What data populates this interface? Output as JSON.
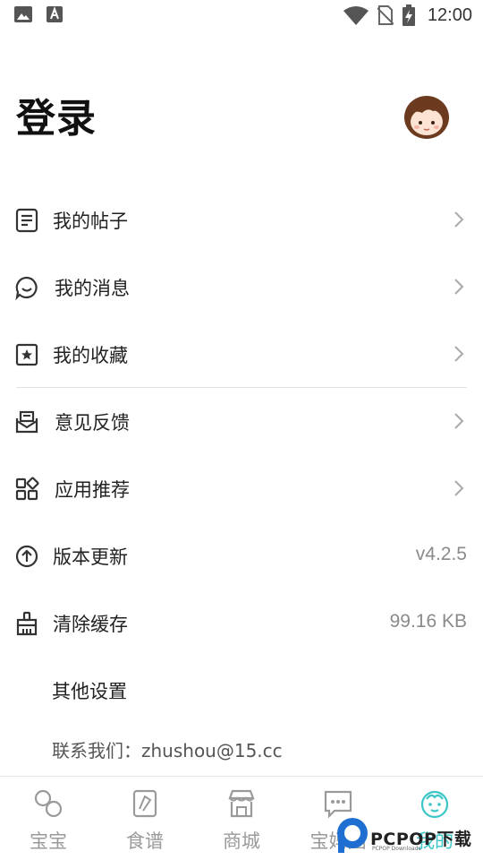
{
  "status_bar": {
    "time": "12:00",
    "left_icons": [
      "image-icon",
      "font-icon"
    ],
    "right_icons": [
      "wifi-icon",
      "no-sim-icon",
      "battery-charging-icon"
    ]
  },
  "header": {
    "title": "登录",
    "avatar_icon": "girl-avatar-icon"
  },
  "menu": {
    "items": [
      {
        "label": "我的帖子",
        "icon": "document-icon",
        "has_chevron": true
      },
      {
        "label": "我的消息",
        "icon": "chat-smile-icon",
        "has_chevron": true
      },
      {
        "label": "我的收藏",
        "icon": "star-box-icon",
        "has_chevron": true
      },
      {
        "label": "意见反馈",
        "icon": "mail-icon",
        "has_chevron": true
      },
      {
        "label": "应用推荐",
        "icon": "apps-grid-icon",
        "has_chevron": true
      },
      {
        "label": "版本更新",
        "icon": "arrow-up-circle-icon",
        "value": "v4.2.5"
      },
      {
        "label": "清除缓存",
        "icon": "broom-icon",
        "value": "99.16 KB"
      },
      {
        "label": "其他设置"
      }
    ],
    "contact": "联系我们：zhushou@15.cc"
  },
  "tabs": [
    {
      "label": "宝宝",
      "icon": "baby-rattle-icon",
      "active": false
    },
    {
      "label": "食谱",
      "icon": "recipe-icon",
      "active": false
    },
    {
      "label": "商城",
      "icon": "store-icon",
      "active": false
    },
    {
      "label": "宝妈圈",
      "icon": "chat-bubble-icon",
      "active": false
    },
    {
      "label": "我的",
      "icon": "baby-face-icon",
      "active": true
    }
  ],
  "colors": {
    "accent": "#3cc6c8",
    "text_primary": "#222222",
    "text_secondary": "#8a8a8a",
    "icon_gray": "#9a9a9a"
  },
  "watermark": {
    "brand": "PCPOP下载",
    "sub": "PCPOP Downloads"
  }
}
